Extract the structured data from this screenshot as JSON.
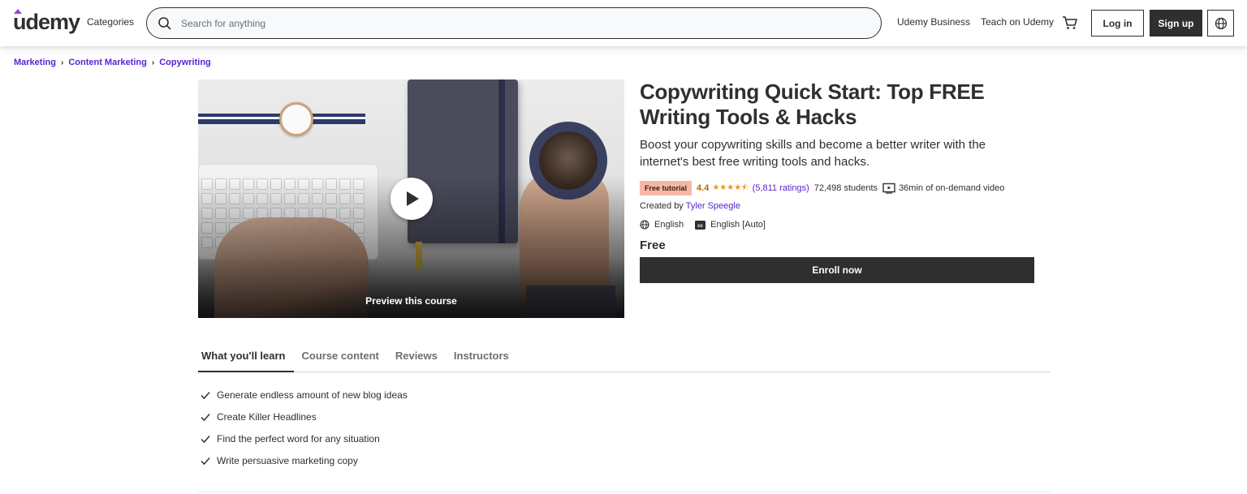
{
  "header": {
    "logo": "udemy",
    "categories_label": "Categories",
    "search_placeholder": "Search for anything",
    "business_label": "Udemy Business",
    "teach_label": "Teach on Udemy",
    "login_label": "Log in",
    "signup_label": "Sign up"
  },
  "breadcrumb": [
    "Marketing",
    "Content Marketing",
    "Copywriting"
  ],
  "preview": {
    "label": "Preview this course"
  },
  "course": {
    "title": "Copywriting Quick Start: Top FREE Writing Tools & Hacks",
    "subtitle": "Boost your copywriting skills and become a better writer with the internet's best free writing tools and hacks.",
    "badge": "Free tutorial",
    "rating": "4.4",
    "ratings_count": "(5,811 ratings)",
    "students": "72,498 students",
    "video_length": "36min of on-demand video",
    "created_by_label": "Created by",
    "instructor": "Tyler Speegle",
    "language": "English",
    "captions": "English [Auto]",
    "price": "Free",
    "enroll_label": "Enroll now"
  },
  "tabs": [
    "What you'll learn",
    "Course content",
    "Reviews",
    "Instructors"
  ],
  "learn_items": [
    "Generate endless amount of new blog ideas",
    "Create Killer Headlines",
    "Find the perfect word for any situation",
    "Write persuasive marketing copy"
  ],
  "colors": {
    "link_purple": "#5624d0",
    "text_dark": "#2d2f31",
    "badge_bg": "#f5b8a6",
    "rating_orange": "#b4690e",
    "star_yellow": "#e59819"
  },
  "icons": {
    "search": "search-icon",
    "cart": "cart-icon",
    "globe": "globe-icon",
    "play": "play-icon",
    "video": "video-icon",
    "language": "globe-icon",
    "captions": "cc-icon",
    "check": "check-icon"
  }
}
